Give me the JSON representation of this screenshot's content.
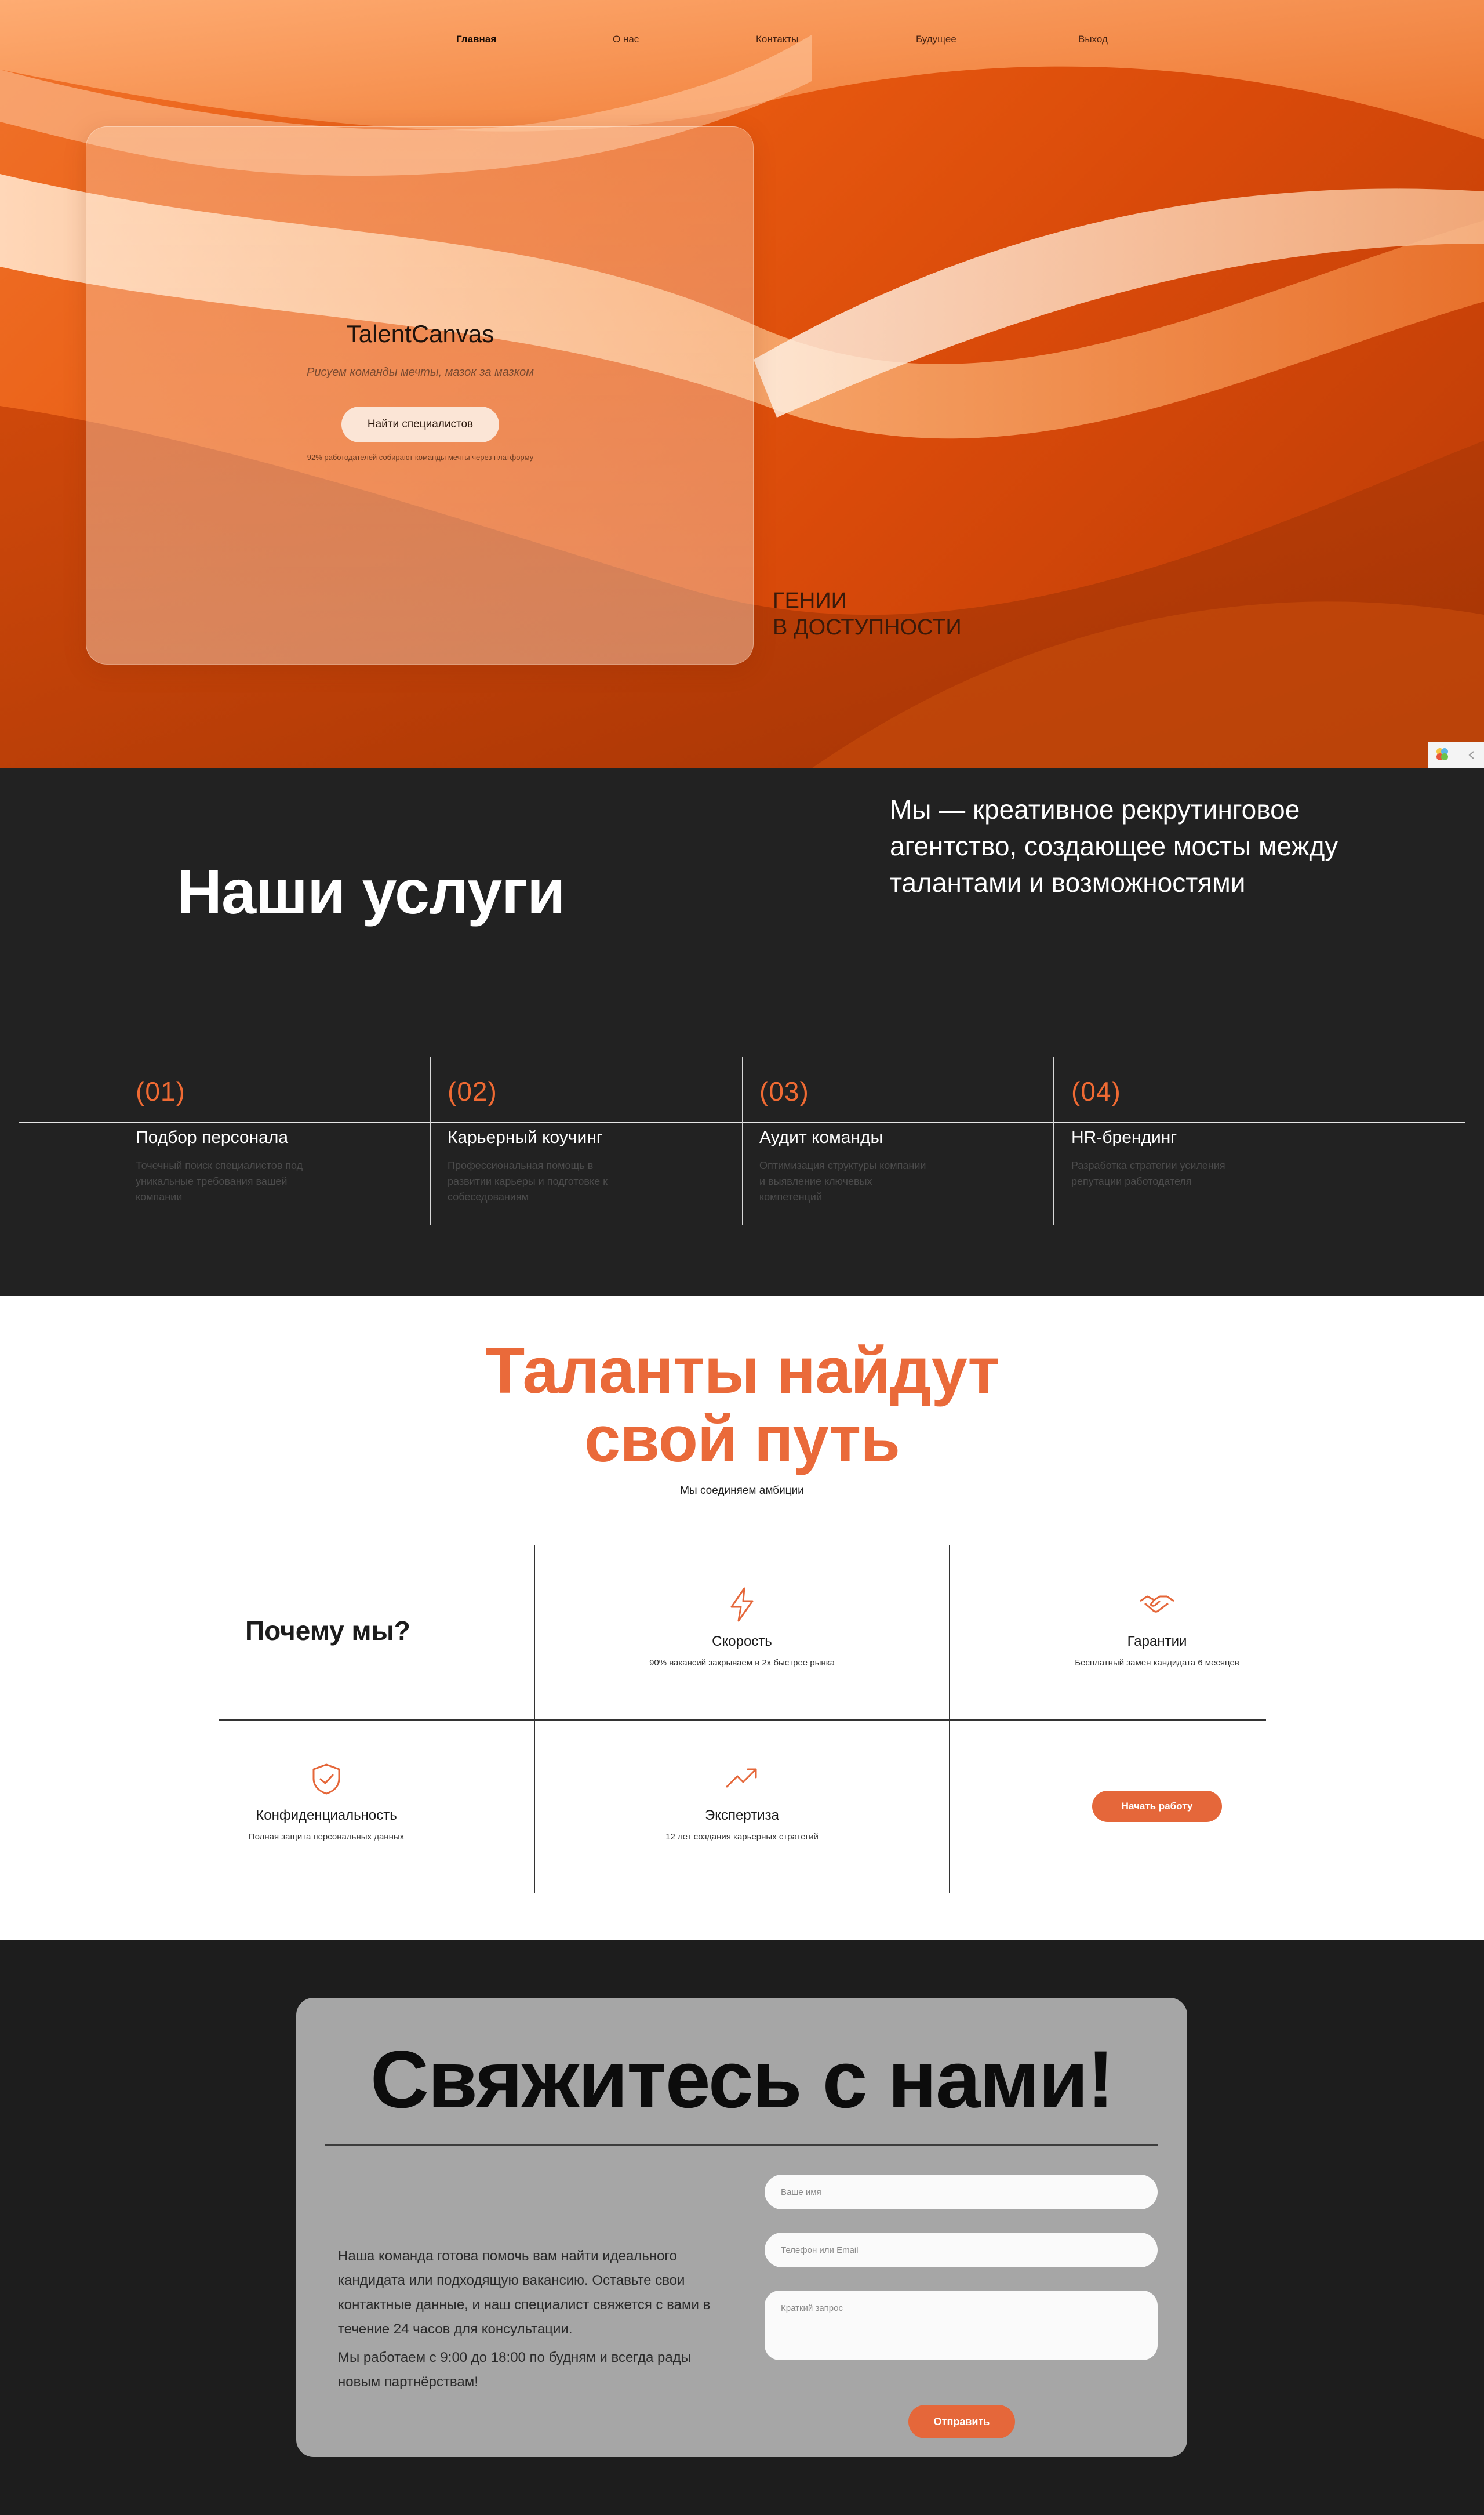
{
  "nav": {
    "items": [
      "Главная",
      "О нас",
      "Контакты",
      "Будущее",
      "Выход"
    ],
    "active_index": 0
  },
  "hero": {
    "brand": "TalentCanvas",
    "tagline": "Рисуем команды мечты, мазок за мазком",
    "cta_label": "Найти специалистов",
    "note": "92% работодателей собирают команды мечты через платформу",
    "genius_line1": "ГЕНИИ",
    "genius_line2": "В ДОСТУПНОСТИ"
  },
  "services": {
    "heading": "Наши услуги",
    "about": "Мы — креативное рекрутинговое агентство, создающее мосты между талантами и возможностями",
    "items": [
      {
        "num": "(01)",
        "title": "Подбор персонала",
        "desc": "Точечный поиск специалистов под уникальные требования вашей компании"
      },
      {
        "num": "(02)",
        "title": "Карьерный коучинг",
        "desc": "Профессиональная помощь в развитии карьеры и подготовке к собеседованиям"
      },
      {
        "num": "(03)",
        "title": "Аудит команды",
        "desc": "Оптимизация структуры компании и выявление ключевых компетенций"
      },
      {
        "num": "(04)",
        "title": "HR-брендинг",
        "desc": "Разработка стратегии усиления репутации работодателя"
      }
    ]
  },
  "why": {
    "title_line1": "Таланты найдут",
    "title_line2": "свой путь",
    "subtitle": "Мы соединяем амбиции",
    "question": "Почему мы?",
    "features": [
      {
        "icon": "lightning-icon",
        "title": "Скорость",
        "desc": "90% вакансий закрываем в 2х быстрее рынка"
      },
      {
        "icon": "handshake-icon",
        "title": "Гарантии",
        "desc": "Бесплатный замен кандидата 6 месяцев"
      },
      {
        "icon": "shield-check-icon",
        "title": "Конфиденциальность",
        "desc": "Полная защита персональных данных"
      },
      {
        "icon": "trending-up-icon",
        "title": "Экспертиза",
        "desc": "12 лет создания карьерных стратегий"
      }
    ],
    "start_label": "Начать работу",
    "accent_color": "#e5673a"
  },
  "contact": {
    "heading": "Свяжитесь с нами!",
    "paragraph1": "Наша команда готова помочь вам найти идеального кандидата или подходящую вакансию. Оставьте свои контактные данные, и наш специалист свяжется с вами в течение 24 часов для консультации.",
    "paragraph2": "Мы работаем с 9:00 до 18:00 по будням и всегда рады новым партнёрствам!",
    "name_placeholder": "Ваше имя",
    "phone_placeholder": "Телефон или Email",
    "request_placeholder": "Краткий запрос",
    "send_label": "Отправить"
  }
}
